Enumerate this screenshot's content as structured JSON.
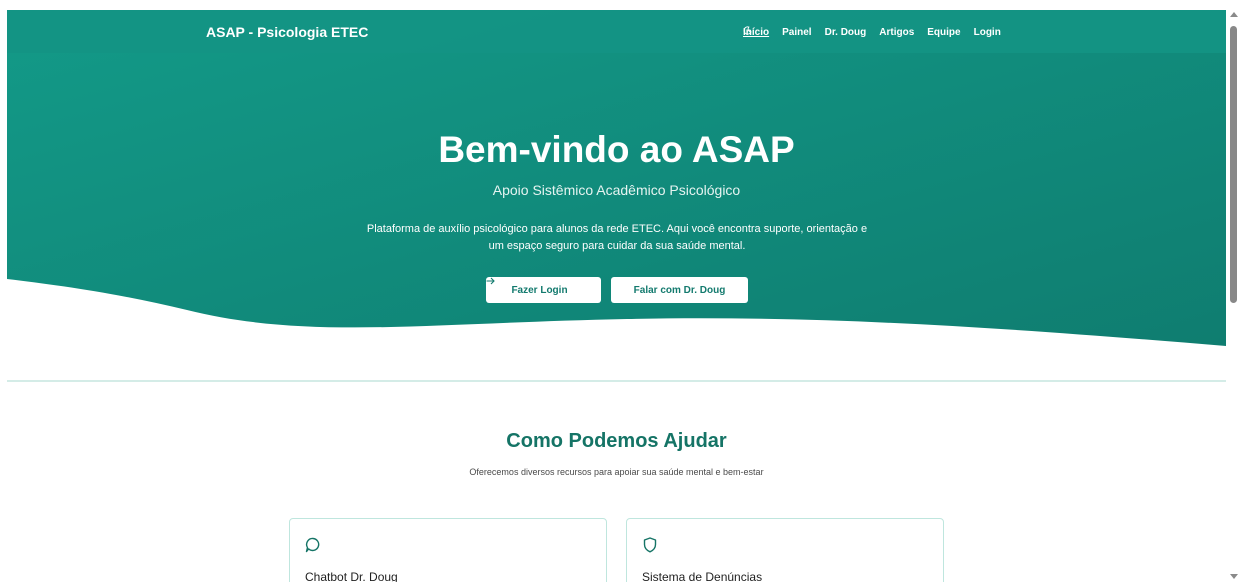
{
  "colors": {
    "brand_teal": "#128d7e",
    "brand_teal_dark": "#0f7a6e",
    "heading_teal": "#157466",
    "card_border": "#bfe6de"
  },
  "navbar": {
    "brand": "ASAP - Psicologia ETEC",
    "links": [
      {
        "label": "Início",
        "active": true
      },
      {
        "label": "Painel"
      },
      {
        "label": "Dr. Doug"
      },
      {
        "label": "Artigos"
      },
      {
        "label": "Equipe"
      },
      {
        "label": "Login"
      }
    ],
    "theme_toggle_icon": "moon-icon"
  },
  "hero": {
    "title": "Bem-vindo ao ASAP",
    "subtitle": "Apoio Sistêmico Acadêmico Psicológico",
    "description_line1": "Plataforma de auxílio psicológico para alunos da rede ETEC. Aqui você encontra suporte, orientação e",
    "description_line2": "um espaço seguro para cuidar da sua saúde mental.",
    "buttons": {
      "login": {
        "label": "Fazer Login",
        "icon": "arrow-right-icon"
      },
      "doug": {
        "label": "Falar com Dr. Doug"
      }
    }
  },
  "help_section": {
    "title": "Como Podemos Ajudar",
    "subtitle": "Oferecemos diversos recursos para apoiar sua saúde mental e bem-estar",
    "cards": [
      {
        "title": "Chatbot Dr. Doug",
        "icon": "chat-bubble-icon"
      },
      {
        "title": "Sistema de Denúncias",
        "icon": "shield-icon"
      }
    ]
  }
}
